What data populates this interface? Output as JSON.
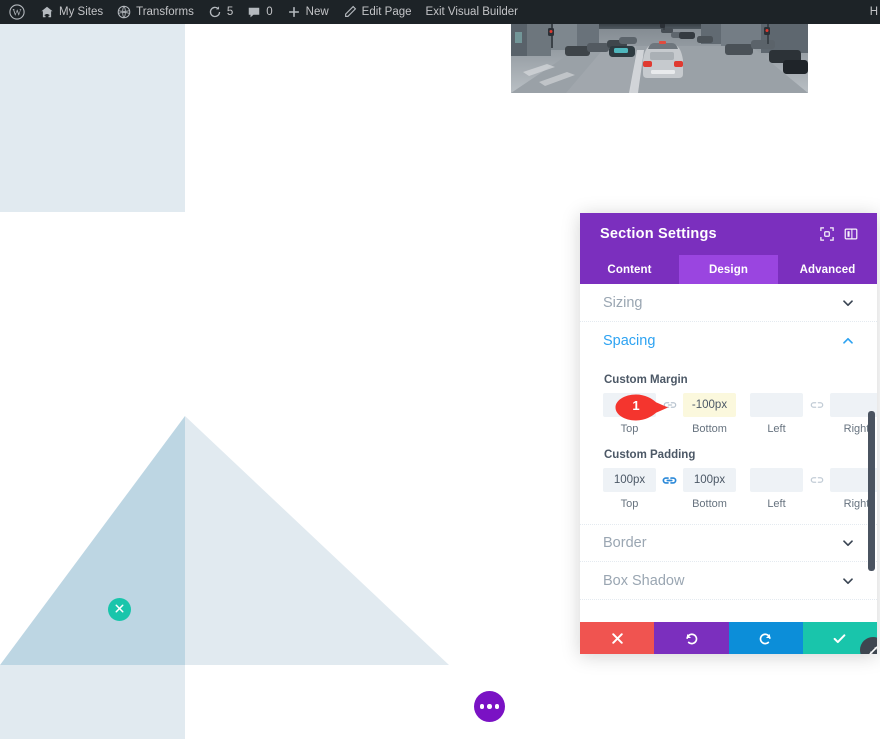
{
  "adminbar": {
    "items": [
      {
        "icon": "wordpress-icon",
        "label": ""
      },
      {
        "icon": "sites-icon",
        "label": "My Sites"
      },
      {
        "icon": "transforms-icon",
        "label": "Transforms"
      },
      {
        "icon": "updates-icon",
        "label": "5"
      },
      {
        "icon": "comments-icon",
        "label": "0"
      },
      {
        "icon": "plus-icon",
        "label": "New"
      },
      {
        "icon": "pencil-icon",
        "label": "Edit Page"
      },
      {
        "icon": "",
        "label": "Exit Visual Builder"
      }
    ],
    "right_label": "H"
  },
  "canvas": {
    "photo_alt": "city street with silver SUV",
    "teal_button_icon": "close-icon",
    "purple_button_icon": "ellipsis-icon",
    "colors": {
      "column_light": "#e1eaf0",
      "triangle_dark": "#bdd6e3",
      "teal": "#19c5ab",
      "purple": "#7a12c4"
    }
  },
  "panel": {
    "title": "Section Settings",
    "header_icons": [
      {
        "name": "focus-mode-icon"
      },
      {
        "name": "panel-layout-icon"
      }
    ],
    "tabs": [
      {
        "label": "Content",
        "active": false
      },
      {
        "label": "Design",
        "active": true
      },
      {
        "label": "Advanced",
        "active": false
      }
    ],
    "accordions": [
      {
        "label": "Sizing",
        "open": false
      },
      {
        "label": "Spacing",
        "open": true
      },
      {
        "label": "Border",
        "open": false
      },
      {
        "label": "Box Shadow",
        "open": false
      }
    ],
    "spacing": {
      "margin": {
        "label": "Custom Margin",
        "top": {
          "value": "",
          "caption": "Top",
          "highlight": false
        },
        "bottom": {
          "value": "-100px",
          "caption": "Bottom",
          "highlight": true
        },
        "left": {
          "value": "",
          "caption": "Left",
          "highlight": false
        },
        "right": {
          "value": "",
          "caption": "Right",
          "highlight": false
        },
        "link_tb": {
          "name": "link-icon",
          "linked": false
        },
        "link_lr": {
          "name": "unlink-icon",
          "linked": false
        }
      },
      "padding": {
        "label": "Custom Padding",
        "top": {
          "value": "100px",
          "caption": "Top",
          "highlight": false
        },
        "bottom": {
          "value": "100px",
          "caption": "Bottom",
          "highlight": false
        },
        "left": {
          "value": "",
          "caption": "Left",
          "highlight": false
        },
        "right": {
          "value": "",
          "caption": "Right",
          "highlight": false
        },
        "link_tb": {
          "name": "link-icon",
          "linked": true
        },
        "link_lr": {
          "name": "unlink-icon",
          "linked": false
        }
      }
    },
    "footer_buttons": [
      {
        "name": "cancel-button",
        "icon": "close-icon",
        "color": "#f05450"
      },
      {
        "name": "undo-button",
        "icon": "undo-icon",
        "color": "#7b2fbe"
      },
      {
        "name": "redo-button",
        "icon": "redo-icon",
        "color": "#0c8ed9"
      },
      {
        "name": "save-button",
        "icon": "check-icon",
        "color": "#19c5ab"
      }
    ]
  },
  "callout": {
    "number": "1",
    "color": "#f4352e"
  }
}
